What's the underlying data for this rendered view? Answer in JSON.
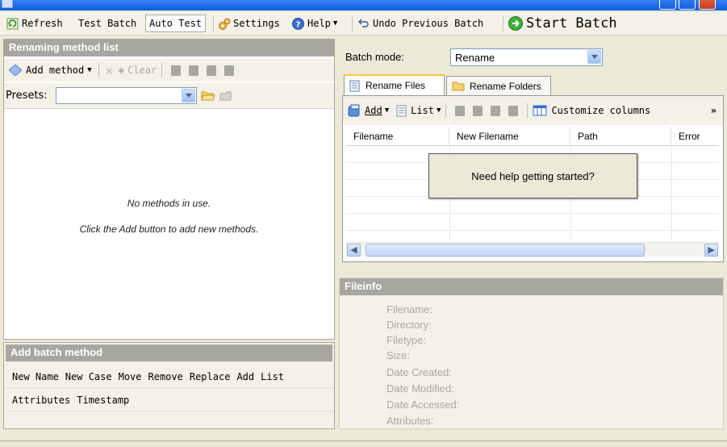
{
  "toolbar": {
    "refresh_label": "Refresh",
    "test_batch_label": "Test Batch",
    "auto_test_label": "Auto Test",
    "settings_label": "Settings",
    "help_label": "Help",
    "undo_label": "Undo Previous Batch",
    "start_label": "Start Batch"
  },
  "left": {
    "header": "Renaming method list",
    "add_method_label": "Add method",
    "clear_label": "Clear",
    "presets_label": "Presets:",
    "empty_line1": "No methods in use.",
    "empty_line2": "Click the Add button to add new methods."
  },
  "batch_method": {
    "header": "Add batch method",
    "row1": [
      "New Name",
      "New Case",
      "Move",
      "Remove",
      "Replace",
      "Add",
      "List"
    ],
    "row2": [
      "Attributes",
      "Timestamp"
    ]
  },
  "right": {
    "batch_mode_label": "Batch mode:",
    "batch_mode_value": "Rename",
    "tabs": [
      "Rename Files",
      "Rename Folders"
    ],
    "add_label": "Add",
    "list_label": "List",
    "customize_label": "Customize columns",
    "columns": [
      "Filename",
      "New Filename",
      "Path",
      "Error"
    ],
    "help_popup": "Need help getting started?"
  },
  "fileinfo": {
    "header": "Fileinfo",
    "labels": [
      "Filename:",
      "Directory:",
      "Filetype:",
      "Size:",
      "Date Created:",
      "Date Modified:",
      "Date Accessed:",
      "Attributes:"
    ]
  },
  "colors": {
    "header_bg": "#a7a7a0",
    "toolbar_bg": "#f3f1e8",
    "window_bg": "#ece9d8",
    "tab_accent": "#ffc83c"
  }
}
